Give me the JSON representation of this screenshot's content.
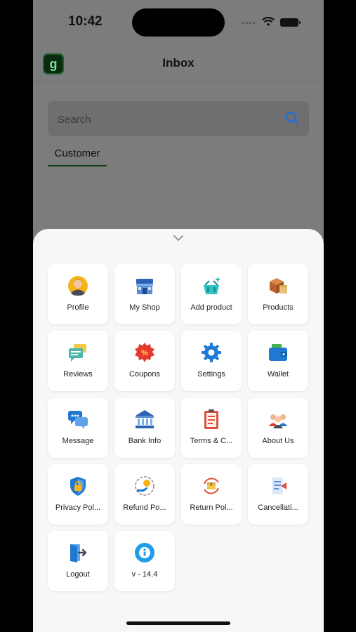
{
  "status": {
    "time": "10:42",
    "dots": "••••"
  },
  "header": {
    "logo": "g",
    "title": "Inbox"
  },
  "search": {
    "placeholder": "Search"
  },
  "tabs": [
    {
      "label": "Customer"
    }
  ],
  "menu": {
    "items": [
      {
        "label": "Profile",
        "icon": "profile-icon"
      },
      {
        "label": "My Shop",
        "icon": "shop-icon"
      },
      {
        "label": "Add product",
        "icon": "add-product-icon"
      },
      {
        "label": "Products",
        "icon": "products-icon"
      },
      {
        "label": "Reviews",
        "icon": "reviews-icon"
      },
      {
        "label": "Coupons",
        "icon": "coupons-icon"
      },
      {
        "label": "Settings",
        "icon": "settings-icon"
      },
      {
        "label": "Wallet",
        "icon": "wallet-icon"
      },
      {
        "label": "Message",
        "icon": "message-icon"
      },
      {
        "label": "Bank Info",
        "icon": "bank-icon"
      },
      {
        "label": "Terms & C...",
        "icon": "terms-icon"
      },
      {
        "label": "About Us",
        "icon": "about-us-icon"
      },
      {
        "label": "Privacy Pol...",
        "icon": "privacy-icon"
      },
      {
        "label": "Refund Po...",
        "icon": "refund-icon"
      },
      {
        "label": "Return Pol...",
        "icon": "return-icon"
      },
      {
        "label": "Cancellati...",
        "icon": "cancellation-icon"
      },
      {
        "label": "Logout",
        "icon": "logout-icon"
      },
      {
        "label": "v - 14.4",
        "icon": "info-icon"
      }
    ]
  },
  "colors": {
    "accent": "#0b3d14",
    "search_icon": "#1e6fd9",
    "sheet_bg": "#f7f7f8"
  }
}
